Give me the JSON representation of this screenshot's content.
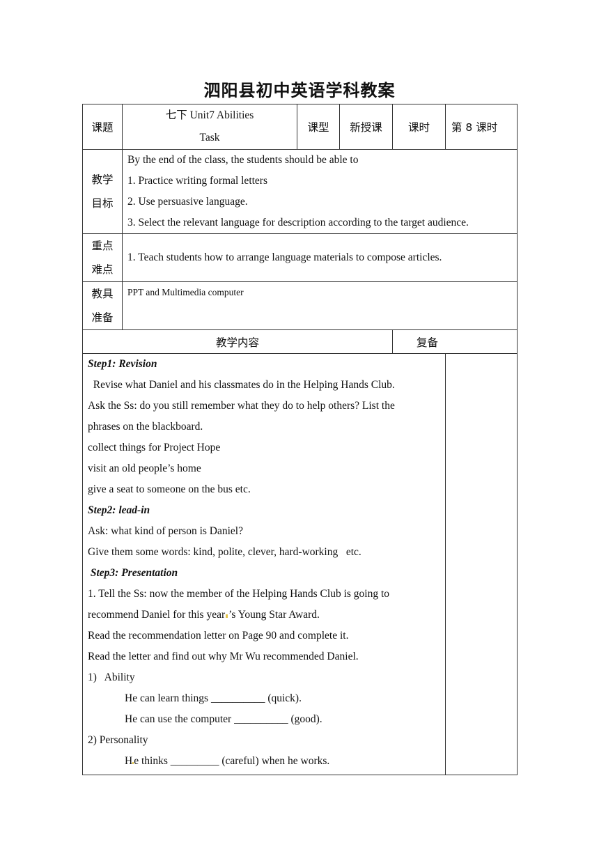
{
  "document": {
    "title": "泗阳县初中英语学科教案",
    "header_row": {
      "topic_label": "课题",
      "topic_line1": "七下 Unit7  Abilities",
      "topic_line2": "Task",
      "type_label": "课型",
      "type_value": "新授课",
      "period_label": "课时",
      "period_value": "第 8 课时"
    },
    "objectives": {
      "label_line1": "教学",
      "label_line2": "目标",
      "lines": [
        "By the end of the class, the students should be able to",
        "1. Practice writing formal letters",
        "2. Use persuasive language.",
        "3. Select the relevant language for description according to the target audience."
      ]
    },
    "key_points": {
      "label_line1": "重点",
      "label_line2": "难点",
      "text": "1.   Teach students how to arrange language materials to compose articles."
    },
    "materials": {
      "label_line1": "教具",
      "label_line2": "准备",
      "text": "PPT and Multimedia computer"
    },
    "content_header": {
      "content_label": "教学内容",
      "review_label": "复备"
    },
    "content": {
      "step1_title": "Step1: Revision",
      "step1_lines": [
        "  Revise what Daniel and his classmates do in the Helping Hands Club.",
        "Ask the Ss: do you still remember what they do to help others? List the",
        "phrases on the blackboard.",
        "collect things for Project Hope",
        "visit an old people’s home",
        "give a seat to someone on the bus etc."
      ],
      "step2_title": "Step2: lead-in",
      "step2_lines": [
        "Ask: what kind of person is Daniel?",
        "Give them some words: kind, polite, clever, hard-working   etc."
      ],
      "step3_title": " Step3: Presentation",
      "step3_line1": "1. Tell the Ss: now the member of the Helping Hands Club is going to",
      "step3_line2a": "recommend Daniel for this year",
      "step3_line2b": "’s Young Star Award.",
      "step3_lines": [
        "Read the recommendation letter on Page 90 and complete it.",
        "Read the letter and find out why Mr Wu recommended Daniel."
      ],
      "ability_heading": "1)   Ability",
      "ability_items": [
        "He can learn things __________ (quick).",
        "He can use the computer __________ (good)."
      ],
      "personality_heading": "2) Personality",
      "personality_a": "H",
      "personality_b": "e thinks _________ (careful) when he works."
    }
  }
}
